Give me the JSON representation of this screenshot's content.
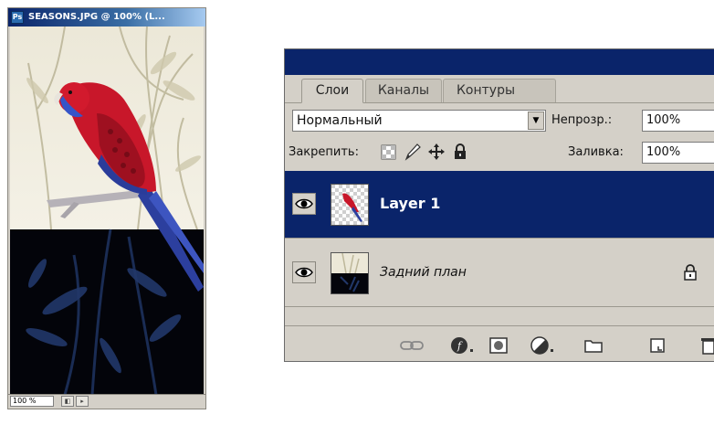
{
  "document": {
    "title": "SEASONS.JPG @ 100% (L...",
    "zoom": "100 %"
  },
  "layers_panel": {
    "tabs": [
      {
        "label": "Слои",
        "active": true
      },
      {
        "label": "Каналы",
        "active": false
      },
      {
        "label": "Контуры",
        "active": false
      }
    ],
    "blend_mode": "Нормальный",
    "opacity_label": "Непрозр.:",
    "opacity_value": "100%",
    "lock_label": "Закрепить:",
    "fill_label": "Заливка:",
    "fill_value": "100%",
    "layers": [
      {
        "name": "Layer 1",
        "selected": true,
        "visible": true,
        "locked": false
      },
      {
        "name": "Задний план",
        "selected": false,
        "visible": true,
        "locked": true
      }
    ],
    "footer_icons": [
      "link-icon",
      "layer-style-icon",
      "layer-mask-icon",
      "adjustment-layer-icon",
      "new-group-icon",
      "new-layer-icon",
      "trash-icon"
    ]
  },
  "colors": {
    "selection": "#0a246a",
    "panel_bg": "#d4d0c8"
  }
}
